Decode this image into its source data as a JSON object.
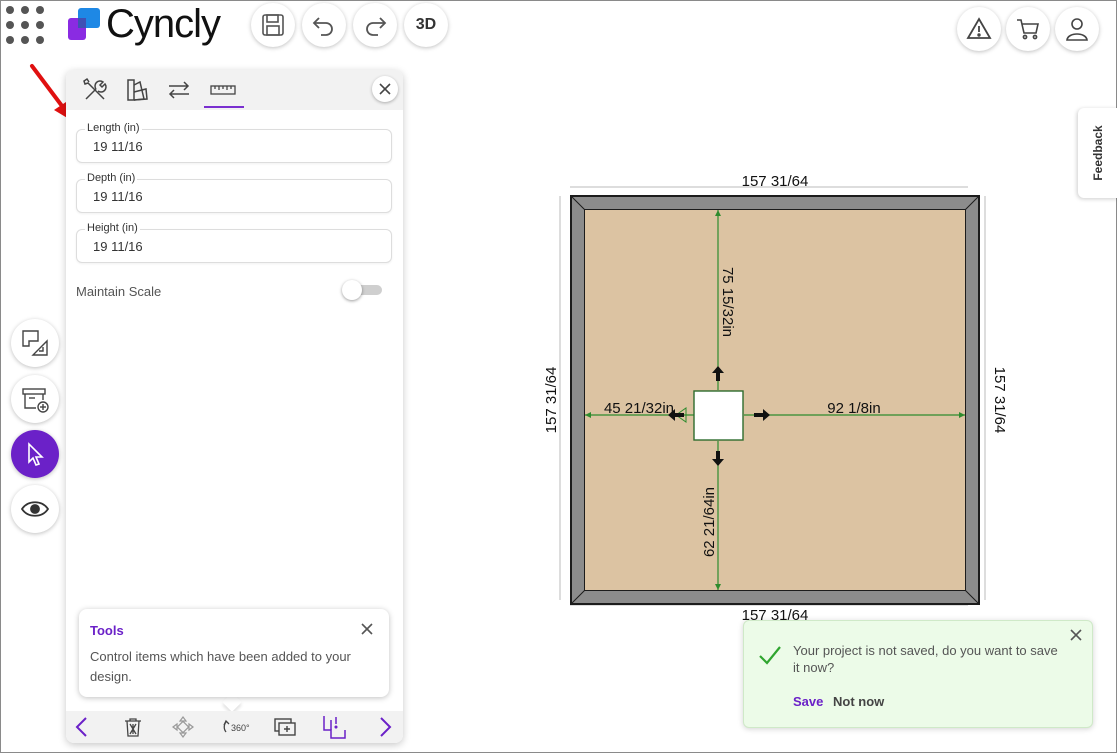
{
  "app": {
    "brand_name": "Cyncly"
  },
  "toolbar": {
    "view_3d_label": "3D"
  },
  "panel": {
    "fields": [
      {
        "label": "Length (in)",
        "value": "19 11/16"
      },
      {
        "label": "Depth (in)",
        "value": "19 11/16"
      },
      {
        "label": "Height (in)",
        "value": "19 11/16"
      }
    ],
    "maintain_scale_label": "Maintain Scale",
    "maintain_scale_on": false,
    "tip": {
      "title": "Tools",
      "body": "Control items which have been added to your design."
    }
  },
  "canvas": {
    "dims": {
      "top": "157 31/64",
      "bottom": "157 31/64",
      "left": "157 31/64",
      "right": "157 31/64",
      "to_top": "75 15/32in",
      "to_bottom": "62 21/64in",
      "to_left": "45 21/32in",
      "to_right": "92 1/8in"
    },
    "colors": {
      "floor": "#dcc3a2",
      "wall": "#8c8c8c",
      "guide": "#2e8b2e"
    }
  },
  "feedback": {
    "label": "Feedback"
  },
  "toast": {
    "message": "Your project is not saved, do you want to save it now?",
    "save_label": "Save",
    "not_now_label": "Not now"
  },
  "colors": {
    "accent": "#6b21c8",
    "toast_bg": "#ecfbe8",
    "annotation": "#e01010"
  },
  "icons": {
    "top": [
      "apps-grid-icon",
      "save-icon",
      "undo-icon",
      "redo-icon",
      "warning-icon",
      "cart-icon",
      "user-icon"
    ],
    "rail": [
      "floorplan-icon",
      "add-item-icon",
      "pointer-icon",
      "eye-icon"
    ],
    "panel_tabs": [
      "tools-icon",
      "material-icon",
      "swap-icon",
      "ruler-icon"
    ],
    "panel_footer": [
      "prev-icon",
      "delete-icon",
      "move-icon",
      "rotate-360-icon",
      "duplicate-icon",
      "warning-item-icon",
      "next-icon"
    ]
  }
}
